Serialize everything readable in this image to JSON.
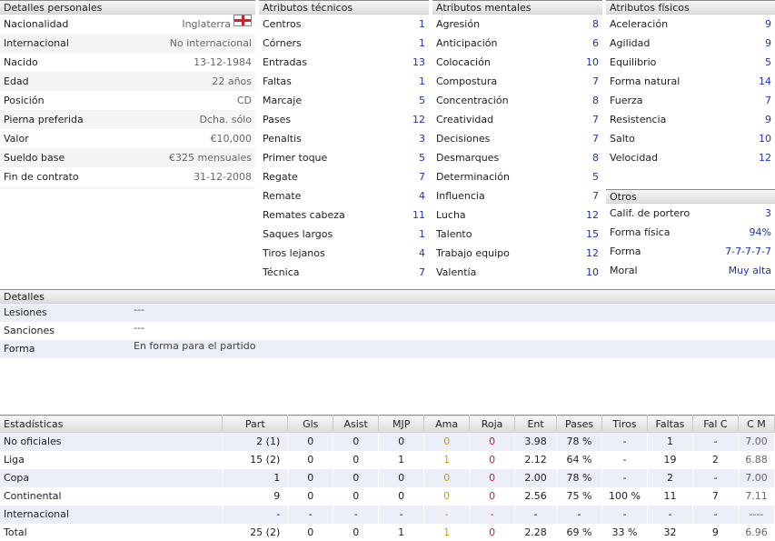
{
  "personal": {
    "title": "Detalles personales",
    "rows": [
      {
        "label": "Nacionalidad",
        "value": "Inglaterra",
        "flag": "england-flag-icon"
      },
      {
        "label": "Internacional",
        "value": "No internacional"
      },
      {
        "label": "Nacido",
        "value": "13-12-1984"
      },
      {
        "label": "Edad",
        "value": "22 años"
      },
      {
        "label": "Posición",
        "value": "CD"
      },
      {
        "label": "Pierna preferida",
        "value": "Dcha. sólo"
      },
      {
        "label": "Valor",
        "value": "€10,000"
      },
      {
        "label": "Sueldo base",
        "value": "€325 mensuales"
      },
      {
        "label": "Fin de contrato",
        "value": "31-12-2008"
      }
    ]
  },
  "tecnicos": {
    "title": "Atributos técnicos",
    "rows": [
      {
        "label": "Centros",
        "value": "1"
      },
      {
        "label": "Córners",
        "value": "1"
      },
      {
        "label": "Entradas",
        "value": "13"
      },
      {
        "label": "Faltas",
        "value": "1"
      },
      {
        "label": "Marcaje",
        "value": "5"
      },
      {
        "label": "Pases",
        "value": "12"
      },
      {
        "label": "Penaltis",
        "value": "3"
      },
      {
        "label": "Primer toque",
        "value": "5"
      },
      {
        "label": "Regate",
        "value": "7"
      },
      {
        "label": "Remate",
        "value": "4"
      },
      {
        "label": "Remates cabeza",
        "value": "11"
      },
      {
        "label": "Saques largos",
        "value": "1"
      },
      {
        "label": "Tiros lejanos",
        "value": "4"
      },
      {
        "label": "Técnica",
        "value": "7"
      }
    ]
  },
  "mentales": {
    "title": "Atributos mentales",
    "rows": [
      {
        "label": "Agresión",
        "value": "8"
      },
      {
        "label": "Anticipación",
        "value": "6"
      },
      {
        "label": "Colocación",
        "value": "10"
      },
      {
        "label": "Compostura",
        "value": "7"
      },
      {
        "label": "Concentración",
        "value": "8"
      },
      {
        "label": "Creatividad",
        "value": "7"
      },
      {
        "label": "Decisiones",
        "value": "7"
      },
      {
        "label": "Desmarques",
        "value": "8"
      },
      {
        "label": "Determinación",
        "value": "5"
      },
      {
        "label": "Influencia",
        "value": "7"
      },
      {
        "label": "Lucha",
        "value": "12"
      },
      {
        "label": "Talento",
        "value": "15"
      },
      {
        "label": "Trabajo equipo",
        "value": "12"
      },
      {
        "label": "Valentía",
        "value": "10"
      }
    ]
  },
  "fisicos": {
    "title": "Atributos físicos",
    "rows": [
      {
        "label": "Aceleración",
        "value": "9"
      },
      {
        "label": "Agilidad",
        "value": "9"
      },
      {
        "label": "Equilibrio",
        "value": "5"
      },
      {
        "label": "Forma natural",
        "value": "14"
      },
      {
        "label": "Fuerza",
        "value": "7"
      },
      {
        "label": "Resistencia",
        "value": "9"
      },
      {
        "label": "Salto",
        "value": "10"
      },
      {
        "label": "Velocidad",
        "value": "12"
      }
    ]
  },
  "otros": {
    "title": "Otros",
    "rows": [
      {
        "label": "Calif. de portero",
        "value": "3"
      },
      {
        "label": "Forma física",
        "value": "94%"
      },
      {
        "label": "Forma",
        "value": "7-7-7-7-7"
      },
      {
        "label": "Moral",
        "value": "Muy alta"
      }
    ]
  },
  "detalles": {
    "title": "Detalles",
    "rows": [
      {
        "label": "Lesiones",
        "value": "---"
      },
      {
        "label": "Sanciones",
        "value": "---"
      },
      {
        "label": "Forma",
        "value": "En forma para el partido"
      }
    ]
  },
  "stats": {
    "headers": [
      "Estadísticas",
      "Part",
      "Gls",
      "Asist",
      "MJP",
      "Ama",
      "Roja",
      "Ent",
      "Pases",
      "Tiros",
      "Faltas",
      "Fal C",
      "C M"
    ],
    "rows": [
      [
        "No oficiales",
        "2 (1)",
        "0",
        "0",
        "0",
        "0",
        "0",
        "3.98",
        "78 %",
        "-",
        "1",
        "-",
        "7.00"
      ],
      [
        "Liga",
        "15 (2)",
        "0",
        "0",
        "1",
        "1",
        "0",
        "2.12",
        "64 %",
        "-",
        "19",
        "2",
        "6.88"
      ],
      [
        "Copa",
        "1",
        "0",
        "0",
        "0",
        "0",
        "0",
        "2.00",
        "78 %",
        "-",
        "2",
        "-",
        "7.00"
      ],
      [
        "Continental",
        "9",
        "0",
        "0",
        "0",
        "0",
        "0",
        "2.56",
        "75 %",
        "100 %",
        "11",
        "7",
        "7.11"
      ],
      [
        "Internacional",
        "-",
        "-",
        "-",
        "-",
        "-",
        "-",
        "-",
        "-",
        "-",
        "-",
        "-",
        "----"
      ],
      [
        "Total",
        "25 (2)",
        "0",
        "0",
        "1",
        "1",
        "0",
        "2.28",
        "69 %",
        "33 %",
        "32",
        "9",
        "6.96"
      ]
    ]
  },
  "colors": {
    "number": "#1a33b8",
    "yellow_card": "#c8a000",
    "red_card": "#d21f2a",
    "stripe": "#eceef8"
  }
}
